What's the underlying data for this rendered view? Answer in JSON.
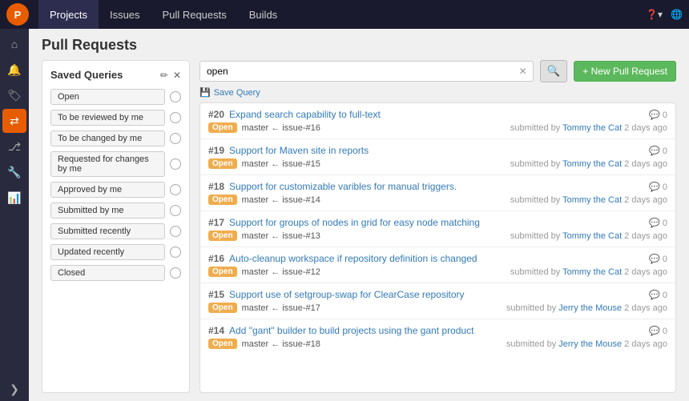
{
  "topNav": {
    "logo": "P",
    "links": [
      "Projects",
      "Issues",
      "Pull Requests",
      "Builds"
    ],
    "activeLink": "Projects"
  },
  "sidebarIcons": [
    {
      "name": "home-icon",
      "symbol": "⌂",
      "active": false
    },
    {
      "name": "bell-icon",
      "symbol": "🔔",
      "active": false
    },
    {
      "name": "settings-icon",
      "symbol": "⚙",
      "active": false
    },
    {
      "name": "tag-icon",
      "symbol": "🏷",
      "active": false
    },
    {
      "name": "pull-request-icon",
      "symbol": "⇄",
      "active": true
    },
    {
      "name": "branch-icon",
      "symbol": "⎇",
      "active": false
    },
    {
      "name": "build-icon",
      "symbol": "🔧",
      "active": false
    },
    {
      "name": "chart-icon",
      "symbol": "📊",
      "active": false
    },
    {
      "name": "expand-icon",
      "symbol": "❯",
      "active": false
    }
  ],
  "pageTitle": "Pull Requests",
  "savedQueries": {
    "title": "Saved Queries",
    "editIcon": "✏",
    "closeIcon": "✕",
    "items": [
      {
        "label": "Open",
        "hasCircle": true
      },
      {
        "label": "To be reviewed by me",
        "hasCircle": true
      },
      {
        "label": "To be changed by me",
        "hasCircle": true
      },
      {
        "label": "Requested for changes by me",
        "hasCircle": true
      },
      {
        "label": "Approved by me",
        "hasCircle": true
      },
      {
        "label": "Submitted by me",
        "hasCircle": true
      },
      {
        "label": "Submitted recently",
        "hasCircle": true
      },
      {
        "label": "Updated recently",
        "hasCircle": true
      },
      {
        "label": "Closed",
        "hasCircle": true
      }
    ]
  },
  "searchBar": {
    "value": "open",
    "clearLabel": "✕",
    "searchIcon": "🔍",
    "newPrLabel": "+ New Pull Request",
    "saveQueryLabel": "Save Query",
    "saveQueryIcon": "💾"
  },
  "pullRequests": [
    {
      "number": "#20",
      "title": "Expand search capability to full-text",
      "comments": "0",
      "badge": "Open",
      "fromBranch": "master",
      "toBranch": "issue-#16",
      "submitter": "Tommy the Cat",
      "time": "2 days ago"
    },
    {
      "number": "#19",
      "title": "Support for Maven site in reports",
      "comments": "0",
      "badge": "Open",
      "fromBranch": "master",
      "toBranch": "issue-#15",
      "submitter": "Tommy the Cat",
      "time": "2 days ago"
    },
    {
      "number": "#18",
      "title": "Support for customizable varibles for manual triggers.",
      "comments": "0",
      "badge": "Open",
      "fromBranch": "master",
      "toBranch": "issue-#14",
      "submitter": "Tommy the Cat",
      "time": "2 days ago"
    },
    {
      "number": "#17",
      "title": "Support for groups of nodes in grid for easy node matching",
      "comments": "0",
      "badge": "Open",
      "fromBranch": "master",
      "toBranch": "issue-#13",
      "submitter": "Tommy the Cat",
      "time": "2 days ago"
    },
    {
      "number": "#16",
      "title": "Auto-cleanup workspace if repository definition is changed",
      "comments": "0",
      "badge": "Open",
      "fromBranch": "master",
      "toBranch": "issue-#12",
      "submitter": "Tommy the Cat",
      "time": "2 days ago"
    },
    {
      "number": "#15",
      "title": "Support use of setgroup-swap for ClearCase repository",
      "comments": "0",
      "badge": "Open",
      "fromBranch": "master",
      "toBranch": "issue-#17",
      "submitter": "Jerry the Mouse",
      "time": "2 days ago"
    },
    {
      "number": "#14",
      "title": "Add \"gant\" builder to build projects using the gant product",
      "comments": "0",
      "badge": "Open",
      "fromBranch": "master",
      "toBranch": "issue-#18",
      "submitter": "Jerry the Mouse",
      "time": "2 days ago"
    }
  ]
}
